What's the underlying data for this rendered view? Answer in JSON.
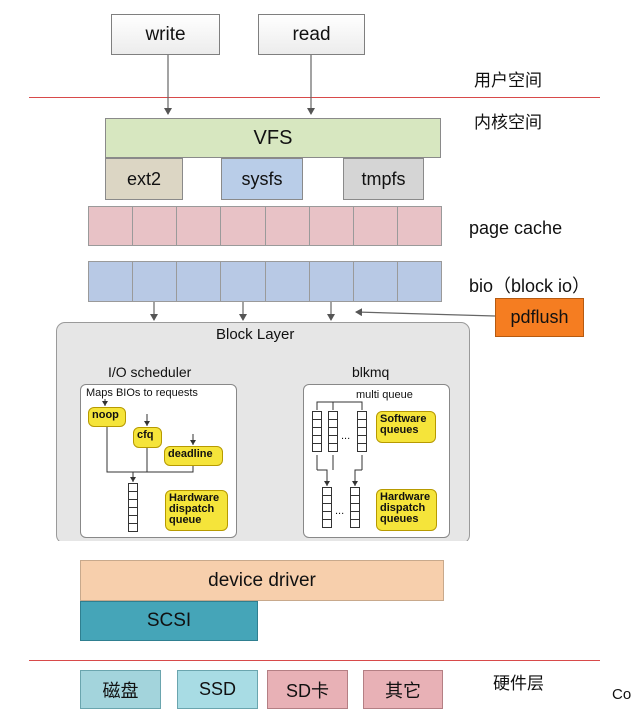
{
  "user_space": {
    "write": "write",
    "read": "read",
    "label": "用户空间"
  },
  "kernel_space": {
    "label": "内核空间",
    "vfs": "VFS",
    "filesystems": [
      "ext2",
      "sysfs",
      "tmpfs"
    ],
    "page_cache": "page  cache",
    "bio": "bio（block io）",
    "pdflush": "pdflush"
  },
  "block_layer": {
    "title": "Block Layer",
    "io_scheduler": {
      "title": "I/O scheduler",
      "subtitle": "Maps BIOs to requests",
      "noop": "noop",
      "cfq": "cfq",
      "deadline": "deadline",
      "hardware_queue": "Hardware dispatch queue"
    },
    "blkmq": {
      "title": "blkmq",
      "subtitle": "multi queue",
      "dots": "...",
      "software_queues": "Software queues",
      "hardware_queues": "Hardware dispatch queues"
    }
  },
  "device_driver": "device  driver",
  "scsi": "SCSI",
  "hardware": {
    "label": "硬件层",
    "devices": [
      "磁盘",
      "SSD",
      "SD卡",
      "其它"
    ]
  },
  "corner_text": "Co",
  "colors": {
    "vfs": "#d7e7c0",
    "ext2": "#dcd6c4",
    "sysfs": "#b9cde8",
    "tmpfs": "#d5d5d5",
    "page_cache": "#e8c2c6",
    "bio": "#b8c9e5",
    "pdflush": "#f57d21",
    "block_layer_bg": "#e6e6e6",
    "device_driver": "#f7cfac",
    "scsi": "#45a5b8",
    "disk": "#a3d4dc",
    "ssd": "#a8dce4",
    "sd_card": "#e8b1b6",
    "other": "#e8b1b6",
    "yellow": "#f5e43a"
  }
}
